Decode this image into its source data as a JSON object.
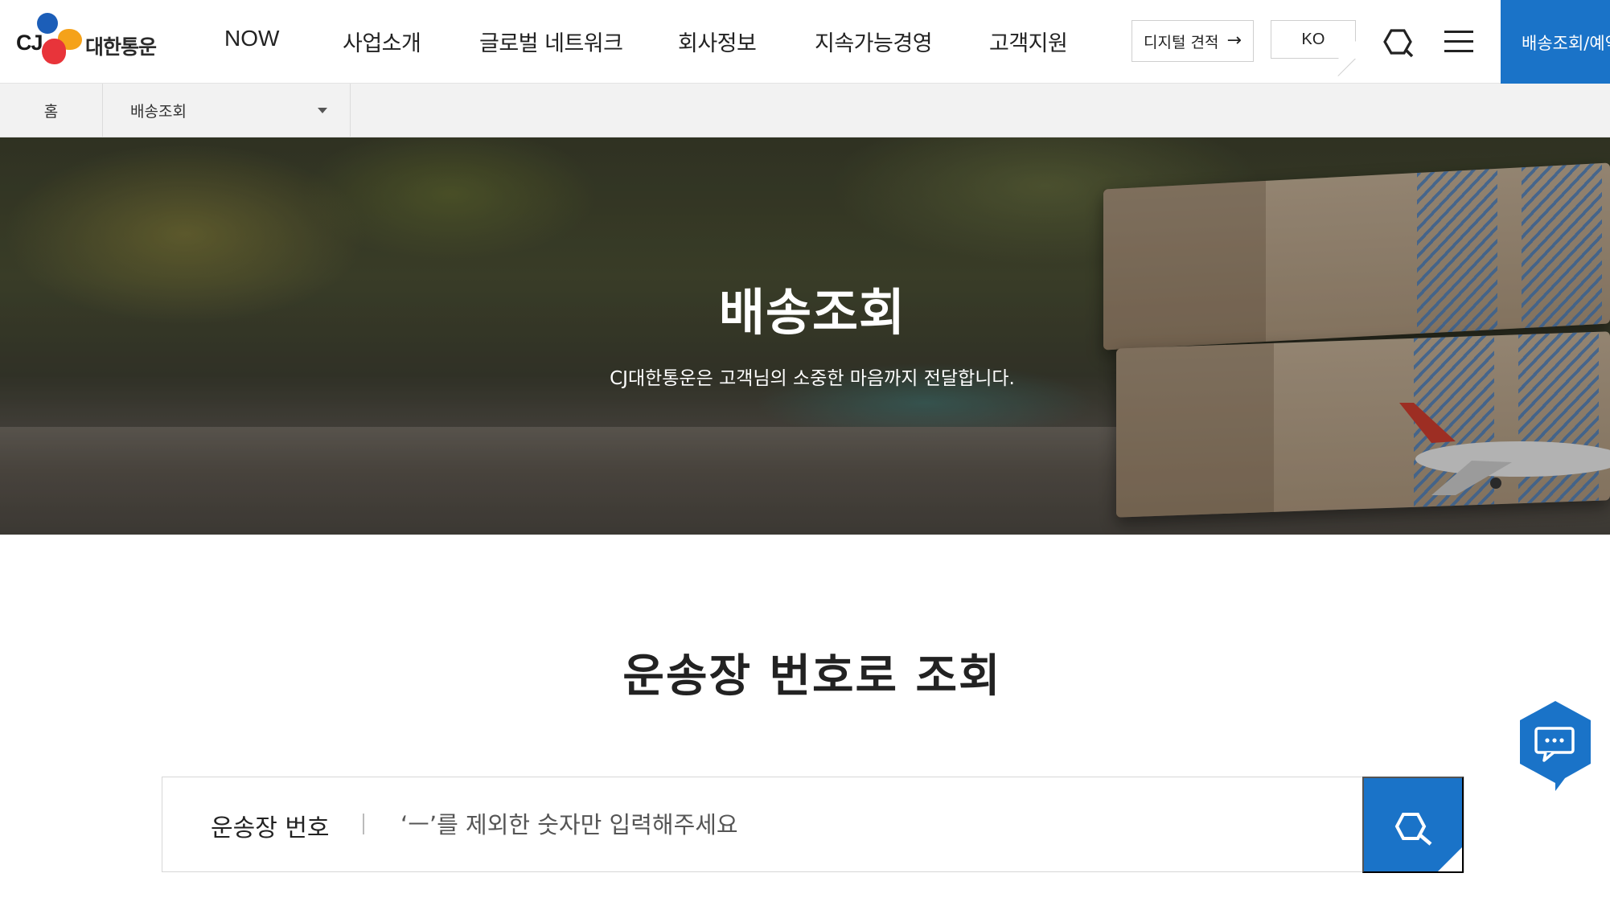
{
  "header": {
    "logo": {
      "mark": "CJ",
      "name": "대한통운"
    },
    "nav": [
      {
        "label": "NOW"
      },
      {
        "label": "사업소개"
      },
      {
        "label": "글로벌 네트워크"
      },
      {
        "label": "회사정보"
      },
      {
        "label": "지속가능경영"
      },
      {
        "label": "고객지원"
      }
    ],
    "quote_button": "디지털 견적",
    "language": "KO",
    "track_button": "배송조회/예약",
    "accent_color": "#1a73c8"
  },
  "breadcrumb": {
    "home": "홈",
    "current": "배송조회"
  },
  "hero": {
    "title": "배송조회",
    "subtitle": "CJ대한통운은 고객님의 소중한 마음까지 전달합니다."
  },
  "search": {
    "title": "운송장 번호로 조회",
    "label": "운송장 번호",
    "placeholder": "‘ㅡ’를 제외한 숫자만 입력해주세요",
    "value": ""
  },
  "icons": {
    "header_search": "search-icon",
    "menu": "hamburger-menu-icon",
    "quote_arrow": "arrow-right-icon",
    "breadcrumb_caret": "caret-down-icon",
    "search_button": "search-icon",
    "chat": "chat-bubble-icon"
  }
}
